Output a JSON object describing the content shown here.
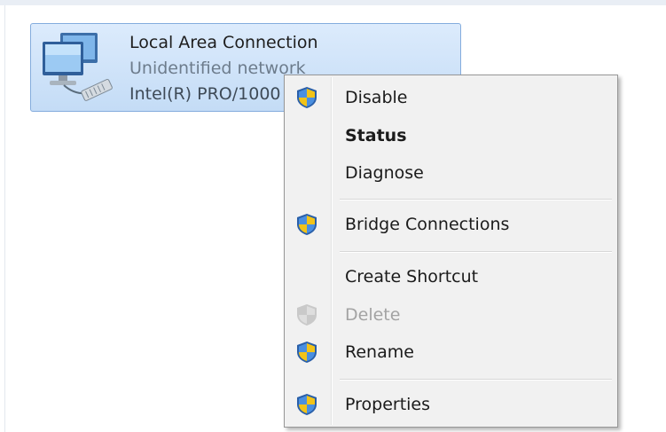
{
  "connection": {
    "name": "Local Area Connection",
    "status": "Unidentified network",
    "adapter": "Intel(R) PRO/1000",
    "icon": "network-adapter-icon"
  },
  "context_menu": {
    "items": [
      {
        "label": "Disable",
        "icon": "uac-shield-icon",
        "bold": false,
        "disabled": false
      },
      {
        "label": "Status",
        "icon": "",
        "bold": true,
        "disabled": false
      },
      {
        "label": "Diagnose",
        "icon": "",
        "bold": false,
        "disabled": false
      },
      {
        "label": "Bridge Connections",
        "icon": "uac-shield-icon",
        "bold": false,
        "disabled": false
      },
      {
        "label": "Create Shortcut",
        "icon": "",
        "bold": false,
        "disabled": false
      },
      {
        "label": "Delete",
        "icon": "uac-shield-icon",
        "bold": false,
        "disabled": true
      },
      {
        "label": "Rename",
        "icon": "uac-shield-icon",
        "bold": false,
        "disabled": false
      },
      {
        "label": "Properties",
        "icon": "uac-shield-icon",
        "bold": false,
        "disabled": false
      }
    ]
  },
  "colors": {
    "selection_bg": "#c4dcf6",
    "selection_border": "#84acdd",
    "menu_bg": "#f1f1f1",
    "disabled_text": "#a3a3a3",
    "shield_blue": "#2f6fc8",
    "shield_yellow": "#f2c318"
  }
}
